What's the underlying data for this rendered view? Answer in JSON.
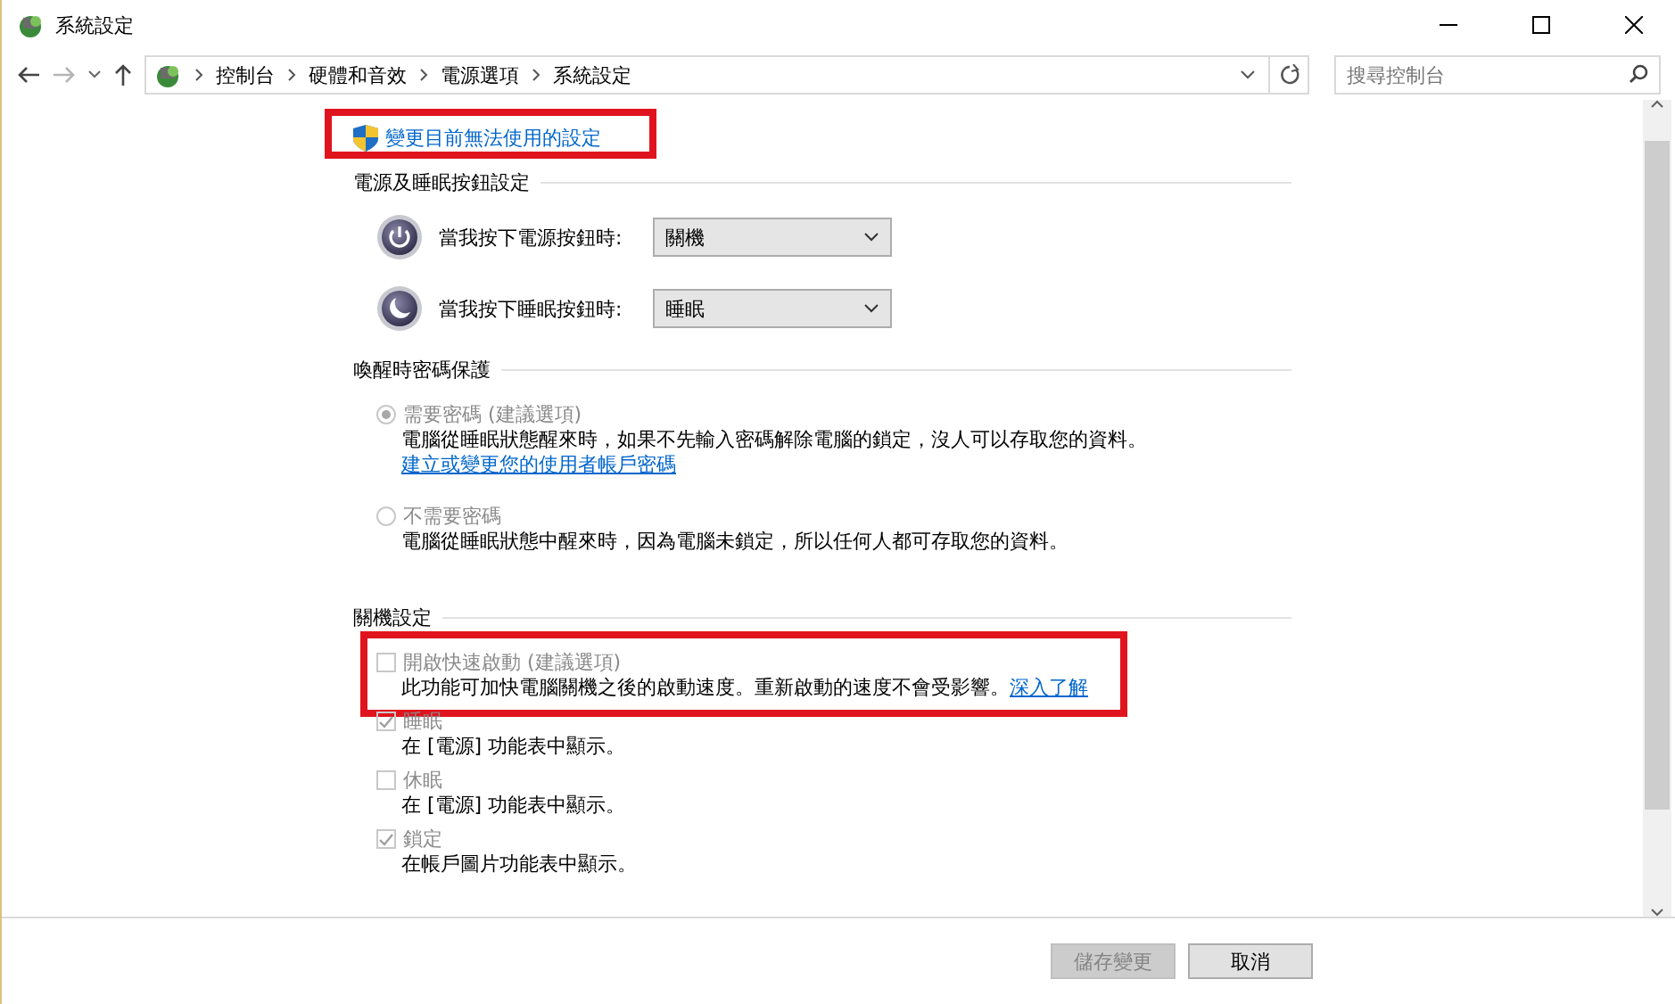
{
  "window": {
    "title": "系統設定"
  },
  "address_bar": {
    "breadcrumbs": [
      "控制台",
      "硬體和音效",
      "電源選項",
      "系統設定"
    ]
  },
  "search": {
    "placeholder": "搜尋控制台"
  },
  "admin_link": {
    "text": "變更目前無法使用的設定",
    "highlighted": true
  },
  "sections": [
    {
      "kind": "buttons",
      "title": "電源及睡眠按鈕設定",
      "rows": [
        {
          "kind": "power",
          "label": "當我按下電源按鈕時:",
          "value": "關機"
        },
        {
          "kind": "sleep",
          "label": "當我按下睡眠按鈕時:",
          "value": "睡眠"
        }
      ]
    },
    {
      "kind": "radios",
      "title": "喚醒時密碼保護",
      "options": [
        {
          "label": "需要密碼 (建議選項)",
          "selected": true,
          "disabled": true,
          "description": "電腦從睡眠狀態醒來時，如果不先輸入密碼解除電腦的鎖定，沒人可以存取您的資料。",
          "link": "建立或變更您的使用者帳戶密碼"
        },
        {
          "label": "不需要密碼",
          "selected": false,
          "disabled": true,
          "description": "電腦從睡眠狀態中醒來時，因為電腦未鎖定，所以任何人都可存取您的資料。"
        }
      ]
    },
    {
      "kind": "checkboxes",
      "title": "關機設定",
      "options": [
        {
          "label": "開啟快速啟動 (建議選項)",
          "checked": false,
          "disabled": true,
          "description": "此功能可加快電腦關機之後的啟動速度。重新啟動的速度不會受影響。",
          "link": "深入了解",
          "highlighted": true
        },
        {
          "label": "睡眠",
          "checked": true,
          "disabled": true,
          "description": "在 [電源] 功能表中顯示。"
        },
        {
          "label": "休眠",
          "checked": false,
          "disabled": true,
          "description": "在 [電源] 功能表中顯示。"
        },
        {
          "label": "鎖定",
          "checked": true,
          "disabled": true,
          "description": "在帳戶圖片功能表中顯示。"
        }
      ]
    }
  ],
  "buttons": [
    {
      "label": "儲存變更",
      "disabled": true
    },
    {
      "label": "取消",
      "disabled": false
    }
  ]
}
